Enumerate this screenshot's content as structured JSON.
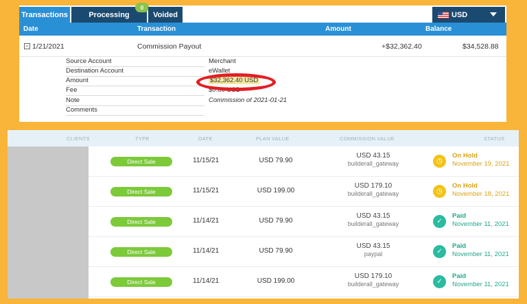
{
  "tabs": [
    {
      "label": "Transactions",
      "active": true
    },
    {
      "label": "Processing",
      "badge": "0"
    },
    {
      "label": "Voided"
    }
  ],
  "currency": {
    "selected": "USD"
  },
  "columns": {
    "date": "Date",
    "transaction": "Transaction",
    "amount": "Amount",
    "balance": "Balance"
  },
  "transaction": {
    "date": "1/21/2021",
    "name": "Commission Payout",
    "amount": "+$32,362.40",
    "balance": "$34,528.88"
  },
  "details": [
    {
      "label": "Source Account",
      "value": "Merchant"
    },
    {
      "label": "Destination Account",
      "value": "eWallet"
    },
    {
      "label": "Amount",
      "value": "$32,362.40 USD"
    },
    {
      "label": "Fee",
      "value": "$0.00 USD"
    },
    {
      "label": "Note",
      "value": "Commission of 2021-01-21"
    },
    {
      "label": "Comments",
      "value": ""
    }
  ],
  "commissions": {
    "headers": [
      "CLIENTS",
      "TYPE",
      "DATE",
      "PLAN VALUE",
      "COMMISSION VALUE",
      "STATUS"
    ],
    "rows": [
      {
        "type": "Direct Sale",
        "date": "11/15/21",
        "plan": "USD 79.90",
        "commission": "USD 43.15",
        "gateway": "builderall_gateway",
        "status": "On Hold",
        "status_date": "November 19, 2021",
        "kind": "hold"
      },
      {
        "type": "Direct Sale",
        "date": "11/15/21",
        "plan": "USD 199.00",
        "commission": "USD 179.10",
        "gateway": "builderall_gateway",
        "status": "On Hold",
        "status_date": "November 18, 2021",
        "kind": "hold"
      },
      {
        "type": "Direct Sale",
        "date": "11/14/21",
        "plan": "USD 79.90",
        "commission": "USD 43.15",
        "gateway": "builderall_gateway",
        "status": "Paid",
        "status_date": "November 11, 2021",
        "kind": "paid"
      },
      {
        "type": "Direct Sale",
        "date": "11/14/21",
        "plan": "USD 79.90",
        "commission": "USD 43.15",
        "gateway": "paypal",
        "status": "Paid",
        "status_date": "November 11, 2021",
        "kind": "paid"
      },
      {
        "type": "Direct Sale",
        "date": "11/14/21",
        "plan": "USD 199.00",
        "commission": "USD 179.10",
        "gateway": "builderall_gateway",
        "status": "Paid",
        "status_date": "November 11, 2021",
        "kind": "paid"
      }
    ]
  },
  "colors": {
    "background": "#f9b43a",
    "tab_active": "#2a90d6",
    "tab_dark": "#1b4a70",
    "highlight": "#e31e24",
    "pill": "#7cc93a",
    "hold": "#f2c318",
    "paid": "#2bbba0"
  },
  "icons": {
    "expand": "minus-square-icon",
    "flag": "us-flag-icon",
    "dropdown": "chevron-down-icon",
    "hold": "clock-icon",
    "paid": "thumbs-up-icon"
  }
}
